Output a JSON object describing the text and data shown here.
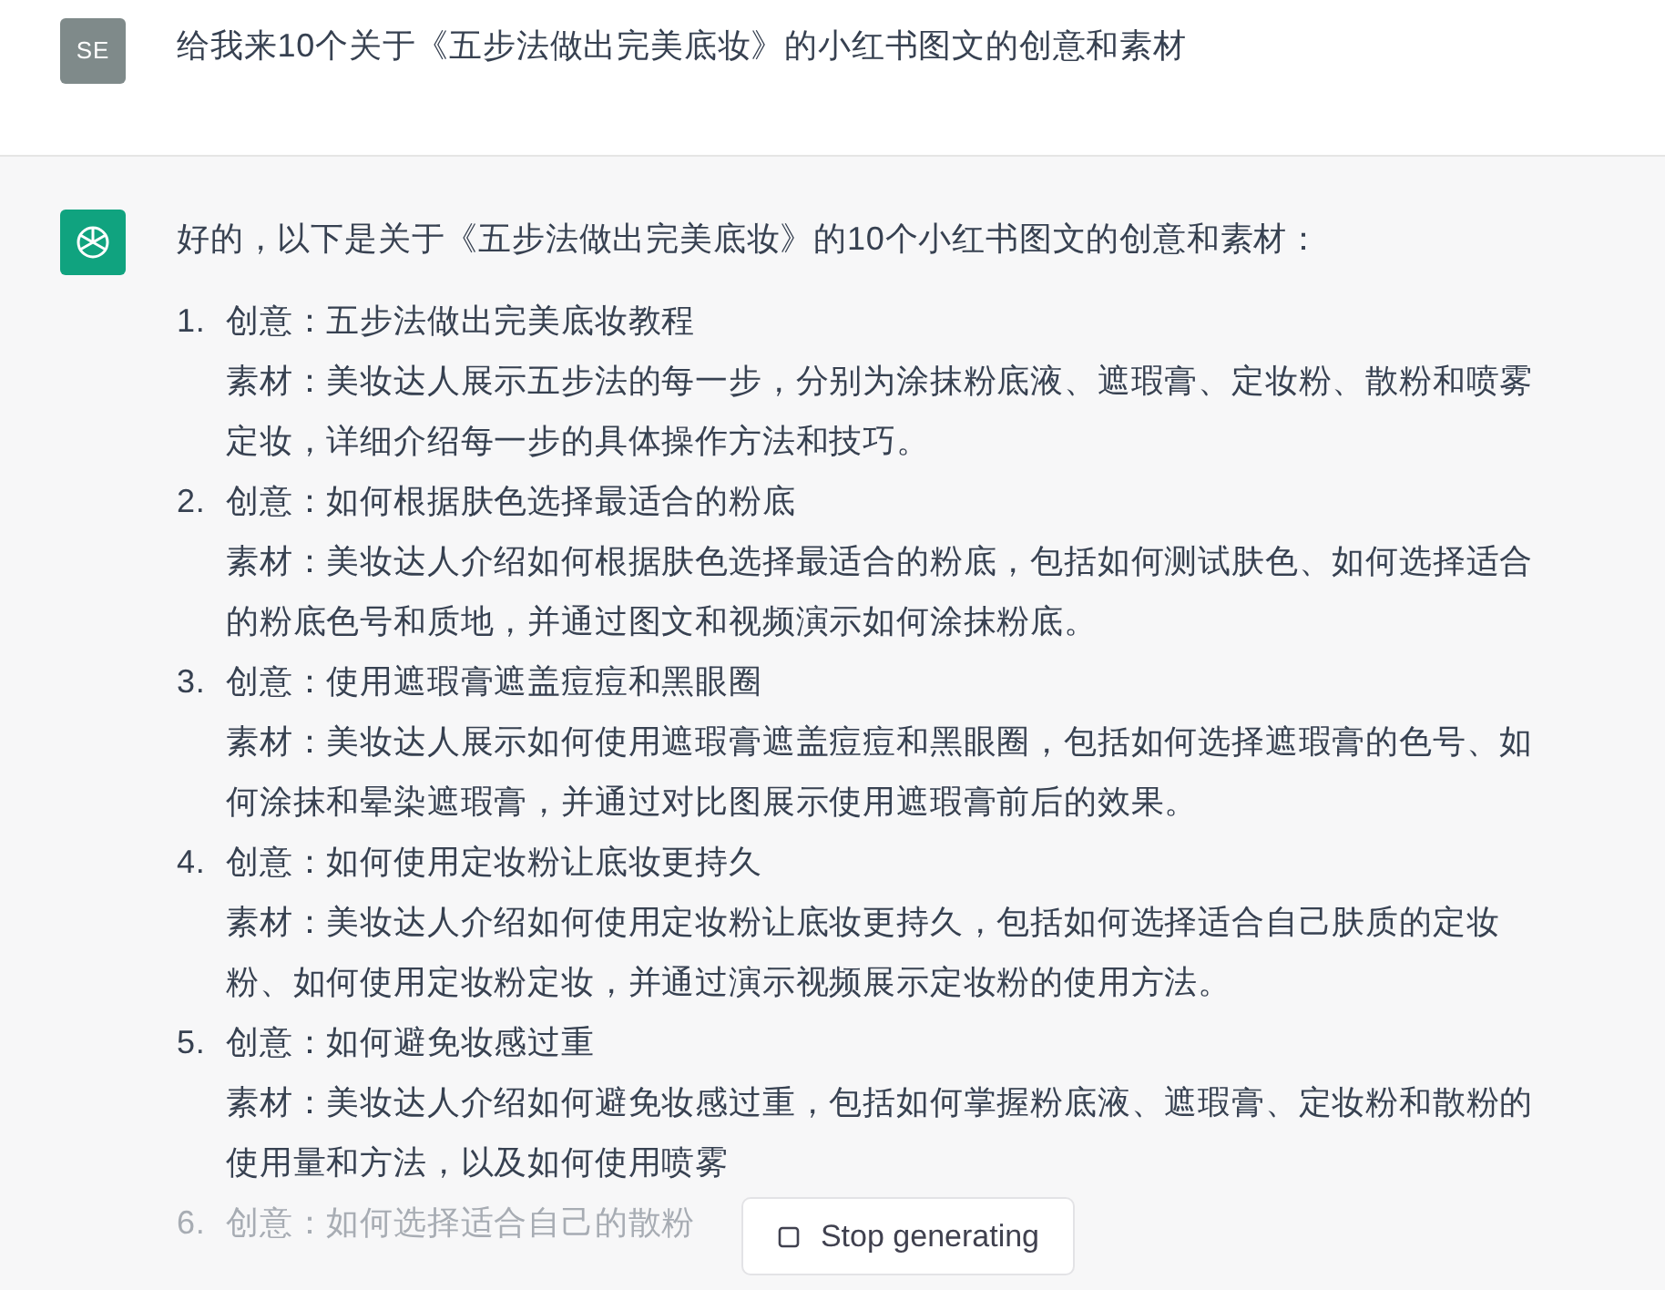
{
  "user_message": {
    "avatar": "SE",
    "text": "给我来10个关于《五步法做出完美底妆》的小红书图文的创意和素材"
  },
  "assistant_message": {
    "intro": "好的，以下是关于《五步法做出完美底妆》的10个小红书图文的创意和素材：",
    "items": [
      {
        "number": "1.",
        "idea": "创意：五步法做出完美底妆教程",
        "material": "素材：美妆达人展示五步法的每一步，分别为涂抹粉底液、遮瑕膏、定妆粉、散粉和喷雾定妆，详细介绍每一步的具体操作方法和技巧。"
      },
      {
        "number": "2.",
        "idea": "创意：如何根据肤色选择最适合的粉底",
        "material": "素材：美妆达人介绍如何根据肤色选择最适合的粉底，包括如何测试肤色、如何选择适合的粉底色号和质地，并通过图文和视频演示如何涂抹粉底。"
      },
      {
        "number": "3.",
        "idea": "创意：使用遮瑕膏遮盖痘痘和黑眼圈",
        "material": "素材：美妆达人展示如何使用遮瑕膏遮盖痘痘和黑眼圈，包括如何选择遮瑕膏的色号、如何涂抹和晕染遮瑕膏，并通过对比图展示使用遮瑕膏前后的效果。"
      },
      {
        "number": "4.",
        "idea": "创意：如何使用定妆粉让底妆更持久",
        "material": "素材：美妆达人介绍如何使用定妆粉让底妆更持久，包括如何选择适合自己肤质的定妆粉、如何使用定妆粉定妆，并通过演示视频展示定妆粉的使用方法。"
      },
      {
        "number": "5.",
        "idea": "创意：如何避免妆感过重",
        "material": "素材：美妆达人介绍如何避免妆感过重，包括如何掌握粉底液、遮瑕膏、定妆粉和散粉的使用量和方法，以及如何使用喷雾"
      },
      {
        "number": "6.",
        "idea": "创意：如何选择适合自己的散粉"
      }
    ]
  },
  "stop_button": {
    "label": "Stop generating"
  }
}
